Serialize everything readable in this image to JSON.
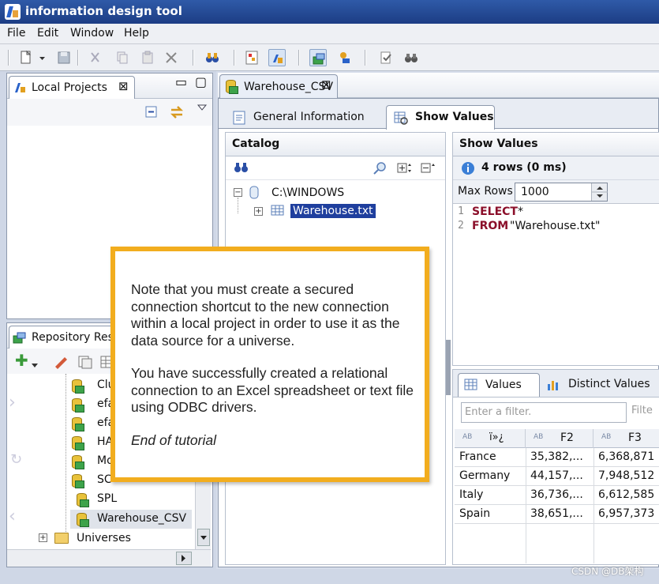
{
  "window": {
    "title": "information design tool"
  },
  "menubar": [
    "File",
    "Edit",
    "Window",
    "Help"
  ],
  "local_projects": {
    "tab_label": "Local Projects"
  },
  "repository": {
    "tab_label": "Repository Res",
    "items": [
      "Clu",
      "efa",
      "efa",
      "HA",
      "Mo",
      "SC",
      "SPL",
      "Warehouse_CSV"
    ],
    "universes_label": "Universes"
  },
  "editor": {
    "tab_label": "Warehouse_CSV",
    "subtabs": {
      "general": "General Information",
      "show_values": "Show Values"
    }
  },
  "catalog": {
    "title": "Catalog",
    "root": "C:\\WINDOWS",
    "child": "Warehouse.txt"
  },
  "show_values": {
    "title": "Show Values",
    "status": "4 rows (0 ms)",
    "max_rows_label": "Max Rows",
    "max_rows_value": "1000",
    "sql": {
      "line1_no": "1",
      "line1_kw": "SELECT",
      "line1_rest": "*",
      "line2_no": "2",
      "line2_kw": "FROM",
      "line2_rest": "\"Warehouse.txt\""
    }
  },
  "values_panel": {
    "tab_values": "Values",
    "tab_distinct": "Distinct Values",
    "filter_placeholder": "Enter a filter.",
    "filter_button": "Filte",
    "columns": [
      {
        "type": "AB",
        "name": "ï»¿"
      },
      {
        "type": "AB",
        "name": "F2"
      },
      {
        "type": "AB",
        "name": "F3"
      }
    ],
    "rows": [
      [
        "France",
        "35,382,...",
        "6,368,871"
      ],
      [
        "Germany",
        "44,157,...",
        "7,948,512"
      ],
      [
        "Italy",
        "36,736,...",
        "6,612,585"
      ],
      [
        "Spain",
        "38,651,...",
        "6,957,373"
      ]
    ]
  },
  "note": {
    "p1": "Note that you must create a secured connection shortcut to the new connection within a local project in order to use it as the data source for a universe.",
    "p2": "You have successfully created a relational connection to an Excel spreadsheet or text file using ODBC drivers.",
    "p3": "End of tutorial"
  },
  "watermark": "CSDN @DB架构",
  "colors": {
    "note_border": "#f2ad1e",
    "selection": "#1f3f9e",
    "sql_keyword": "#8b0f2a"
  }
}
